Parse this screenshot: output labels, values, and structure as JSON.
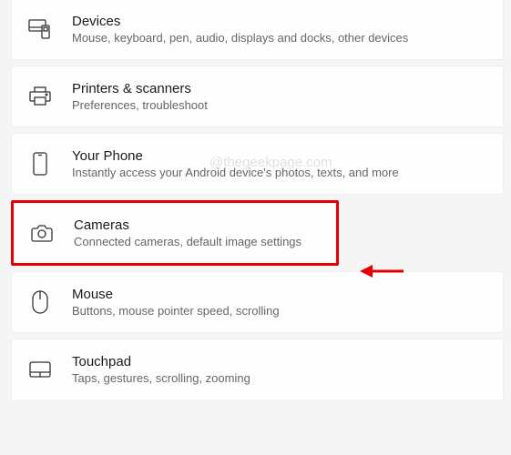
{
  "watermark": "@thegeekpage.com",
  "items": [
    {
      "title": "Devices",
      "subtitle": "Mouse, keyboard, pen, audio, displays and docks, other devices"
    },
    {
      "title": "Printers & scanners",
      "subtitle": "Preferences, troubleshoot"
    },
    {
      "title": "Your Phone",
      "subtitle": "Instantly access your Android device's photos, texts, and more"
    },
    {
      "title": "Cameras",
      "subtitle": "Connected cameras, default image settings"
    },
    {
      "title": "Mouse",
      "subtitle": "Buttons, mouse pointer speed, scrolling"
    },
    {
      "title": "Touchpad",
      "subtitle": "Taps, gestures, scrolling, zooming"
    }
  ]
}
